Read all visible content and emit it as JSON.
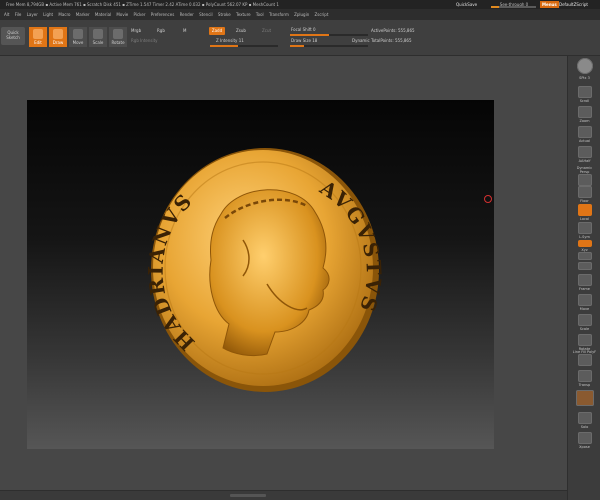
{
  "status_bar": {
    "text": "Free Mem 8,794GB  ▪  Active Mem 761  ▪  Scratch Disk 451  ▪  ZTime 1.547  Timer 2.42  ATime 0.032  ▪  PolyCount 562.07 KP  ▪  MeshCount 1",
    "quicksave": "QuickSave",
    "see_through": "See-through  0",
    "menus": "Menus",
    "default_script": "DefaultZScript"
  },
  "menu_bar": {
    "items": [
      "Alt",
      "File",
      "Layer",
      "Light",
      "Macro",
      "Marker",
      "Material",
      "Movie",
      "Picker",
      "Preferences",
      "Render",
      "Stencil",
      "Stroke",
      "Texture",
      "Tool",
      "Transform",
      "Zplugin",
      "Zscript"
    ]
  },
  "top_shelf": {
    "quick_sketch": "Quick Sketch",
    "edit": "Edit",
    "draw": "Draw",
    "move": "Move",
    "scale": "Scale",
    "rotate": "Rotate",
    "mrgb": "Mrgb",
    "rgb": "Rgb",
    "m": "M",
    "rgb_intensity": "Rgb Intensity",
    "zadd": "Zadd",
    "zsub": "Zsub",
    "zcut": "Zcut",
    "z_intensity": "Z Intensity 11",
    "focal_shift": "Focal Shift 0",
    "draw_size": "Draw Size 18",
    "dynamic": "Dynamic",
    "active_points": "ActivePoints: 555,865",
    "total_points": "TotalPoints: 555,865"
  },
  "right_tray": {
    "items": [
      {
        "label": "",
        "icon": "material-sphere-icon",
        "active": false
      },
      {
        "label": "SPix 3",
        "icon": "spix-icon",
        "active": false
      },
      {
        "label": "Scroll",
        "icon": "scroll-icon",
        "active": false
      },
      {
        "label": "Zoom",
        "icon": "zoom-icon",
        "active": false
      },
      {
        "label": "Actual",
        "icon": "actual-icon",
        "active": false
      },
      {
        "label": "AAHalf",
        "icon": "aahalf-icon",
        "active": false
      },
      {
        "label": "Dynamic Persp",
        "icon": "persp-icon",
        "active": false
      },
      {
        "label": "Floor",
        "icon": "floor-icon",
        "active": false
      },
      {
        "label": "Local",
        "icon": "local-icon",
        "active": true
      },
      {
        "label": "L.Sym",
        "icon": "lsym-icon",
        "active": false
      },
      {
        "label": "Xyz",
        "icon": "xyz-icon",
        "active": true
      },
      {
        "label": "",
        "icon": "rot-y-icon",
        "active": false
      },
      {
        "label": "",
        "icon": "rot-z-icon",
        "active": false
      },
      {
        "label": "Frame",
        "icon": "frame-icon",
        "active": false
      },
      {
        "label": "Move",
        "icon": "move-view-icon",
        "active": false
      },
      {
        "label": "Scale",
        "icon": "scale-view-icon",
        "active": false
      },
      {
        "label": "Rotate",
        "icon": "rotate-view-icon",
        "active": false
      },
      {
        "label": "Line Fill PolyF",
        "icon": "polyframe-icon",
        "active": false
      },
      {
        "label": "Transp",
        "icon": "transp-icon",
        "active": false
      },
      {
        "label": "",
        "icon": "ghost-icon",
        "active": false
      },
      {
        "label": "Solo",
        "icon": "solo-icon",
        "active": false
      },
      {
        "label": "Xpose",
        "icon": "xpose-icon",
        "active": false
      }
    ]
  },
  "coin": {
    "left_legend": "HADRIANVS",
    "right_legend": "AVGVSTVS",
    "gold": "#e8a534",
    "gold_dark": "#a86a10",
    "gold_light": "#ffd27a"
  },
  "colors": {
    "accent": "#e07516",
    "panel": "#3f3f3f",
    "status_bg": "#232323"
  }
}
